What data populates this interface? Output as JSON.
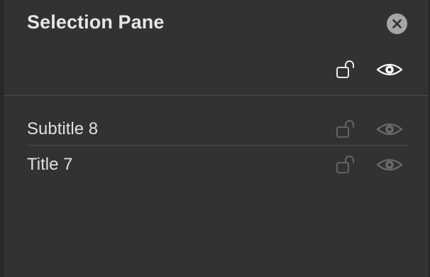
{
  "pane": {
    "title": "Selection Pane"
  },
  "header": {
    "close_icon": "close-icon",
    "lock_icon": "unlock-icon",
    "visibility_icon": "eye-icon"
  },
  "items": [
    {
      "label": "Subtitle 8",
      "locked": false,
      "visible": true
    },
    {
      "label": "Title 7",
      "locked": false,
      "visible": true
    }
  ],
  "colors": {
    "background": "#323232",
    "text": "#e0e0e0",
    "header_icon": "#ffffff",
    "row_icon": "#6a6a6a",
    "divider": "#4a4a4a",
    "close_button": "#a6a6a6"
  }
}
